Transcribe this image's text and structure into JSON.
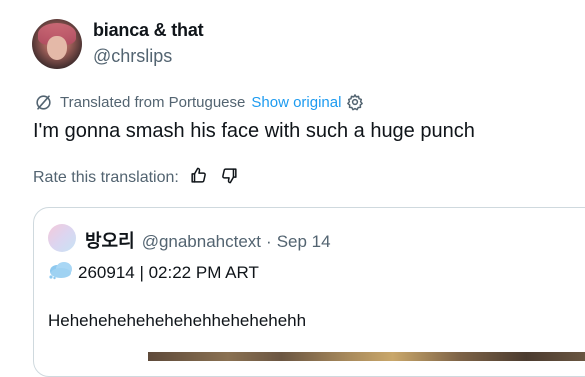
{
  "author": {
    "display_name": "bianca & that",
    "handle": "@chrslips"
  },
  "translation": {
    "translated_from": "Translated from Portuguese",
    "show_original": "Show original"
  },
  "tweet": {
    "text": "I'm gonna smash his face with such a huge punch"
  },
  "rate": {
    "label": "Rate this translation:"
  },
  "quote": {
    "name": "방오리",
    "handle": "@gnabnahctext",
    "separator": "·",
    "date": "Sep 14",
    "line1": "260914 | 02:22 PM ART",
    "line2": "Hehehehehehehehehhehehehehh"
  },
  "colors": {
    "link": "#1d9bf0",
    "secondary_text": "#536471",
    "primary_text": "#0f1419",
    "border": "#cfd9de"
  },
  "icons": {
    "translate": "translate-off-icon",
    "settings": "gear-icon",
    "like": "thumbs-up-icon",
    "dislike": "thumbs-down-icon",
    "quote_emoji": "cloud-emoji-icon"
  }
}
